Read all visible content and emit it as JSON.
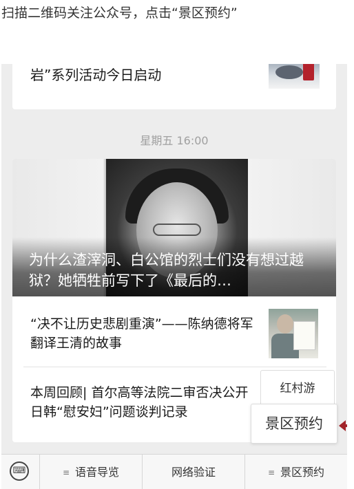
{
  "instruction": "扫描二维码关注公众号，点击“景区预约”",
  "feed": {
    "top_card_title": "岩”系列活动今日启动",
    "timestamp": "星期五 16:00",
    "hero_title": "为什么渣滓洞、白公馆的烈士们没有想过越狱？她牺牲前写下了《最后的…",
    "items": [
      {
        "title": "“决不让历史悲剧重演”——陈纳德将军翻译王清的故事"
      },
      {
        "title": "本周回顾| 首尔高等法院二审否决公开 日韩“慰安妇”问题谈判记录"
      }
    ]
  },
  "menu_popup": {
    "items": [
      "红村游",
      "景区预约"
    ]
  },
  "menubar": {
    "keyboard_icon": "keyboard-icon",
    "items": [
      "语音导览",
      "网络验证",
      "景区预约"
    ]
  },
  "colors": {
    "arrow": "#a2242a",
    "background": "#ededed"
  }
}
